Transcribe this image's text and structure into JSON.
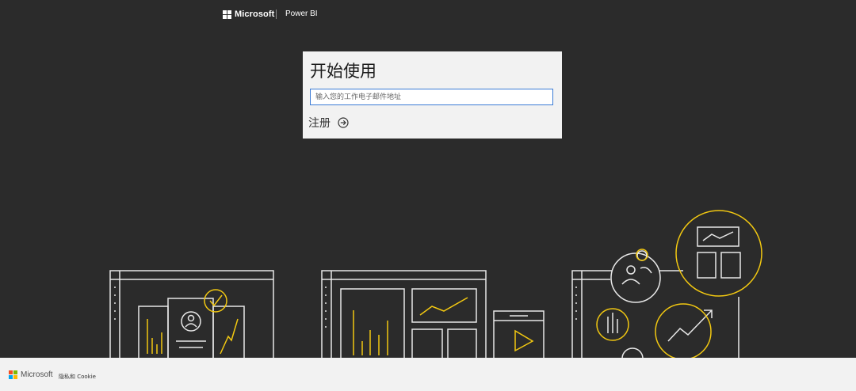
{
  "header": {
    "brand": "Microsoft",
    "product": "Power BI"
  },
  "signin": {
    "title": "开始使用",
    "email_placeholder": "输入您的工作电子邮件地址",
    "email_value": "",
    "signup_label": "注册",
    "signup_icon": "arrow-circle-right-icon"
  },
  "footer": {
    "brand": "Microsoft",
    "privacy_link": "隐私和 Cookie"
  },
  "colors": {
    "background": "#2b2b2b",
    "card": "#f2f2f2",
    "accent_yellow": "#f2c811",
    "input_border": "#3a7bd5",
    "ms_red": "#f25022",
    "ms_green": "#7fba00",
    "ms_blue": "#00a4ef",
    "ms_yellow": "#ffb900"
  }
}
